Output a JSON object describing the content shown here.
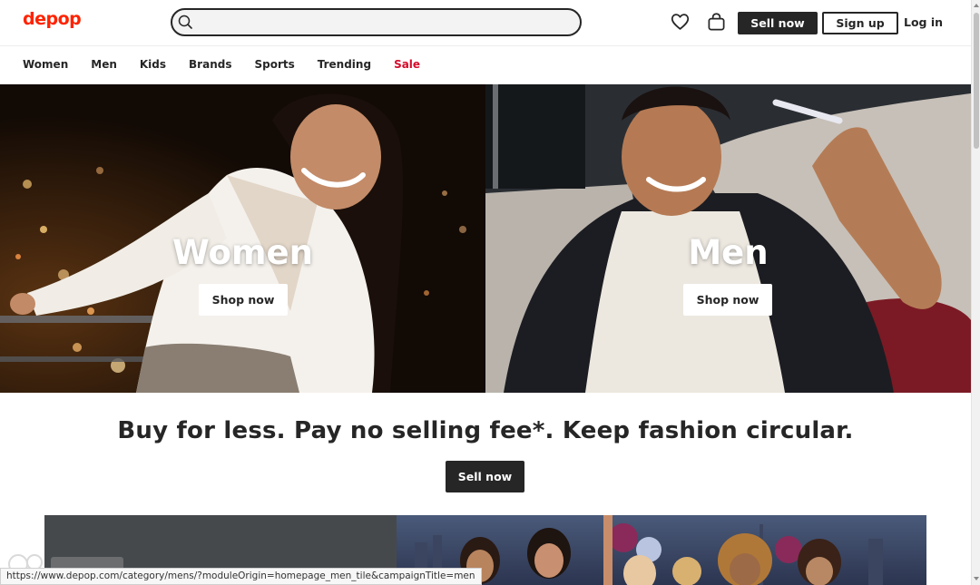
{
  "header": {
    "logo": "depop",
    "search_value": "",
    "sell_now": "Sell now",
    "sign_up": "Sign up",
    "log_in": "Log in"
  },
  "nav": {
    "items": [
      "Women",
      "Men",
      "Kids",
      "Brands",
      "Sports",
      "Trending",
      "Sale"
    ]
  },
  "hero": {
    "women": {
      "title": "Women",
      "button": "Shop now"
    },
    "men": {
      "title": "Men",
      "button": "Shop now"
    }
  },
  "main": {
    "tagline": "Buy for less. Pay no selling fee*. Keep fashion circular.",
    "sell_now": "Sell now"
  },
  "status_bar": {
    "url": "https://www.depop.com/category/mens/?moduleOrigin=homepage_men_tile&campaignTitle=men"
  },
  "colors": {
    "brand": "#ff2300",
    "sale": "#d50c2b",
    "dark": "#262626"
  }
}
